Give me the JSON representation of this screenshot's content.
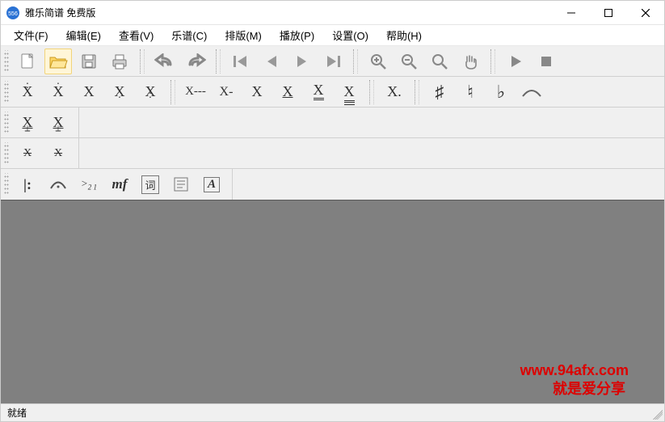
{
  "titlebar": {
    "title": "雅乐简谱 免费版"
  },
  "menu": {
    "file": "文件(F)",
    "edit": "编辑(E)",
    "view": "查看(V)",
    "score": "乐谱(C)",
    "layout": "排版(M)",
    "play": "播放(P)",
    "settings": "设置(O)",
    "help": "帮助(H)"
  },
  "toolbar1": {
    "new": "新建",
    "open": "打开",
    "save": "保存",
    "print": "打印",
    "undo": "撤销",
    "redo": "重做",
    "first": "首段",
    "prev": "上段",
    "next": "下段",
    "last": "末段",
    "zoomin": "放大",
    "zoomout": "缩小",
    "zoomfit": "缩放",
    "pan": "平移",
    "playbtn": "播放",
    "stop": "停止"
  },
  "row2": {
    "n1": "X",
    "n2": "X",
    "n3": "X",
    "n4": "X",
    "n5": "X",
    "d1": "X---",
    "d2": "X-",
    "d3": "X",
    "d4": "X",
    "d5": "X",
    "d6": "X",
    "dot": "X.",
    "sharp": "♯",
    "natural": "♮",
    "flat": "♭",
    "slur": "⌒"
  },
  "row3": {
    "t1": "X",
    "t2": "X",
    "t3": "X",
    "t4": "X"
  },
  "row4": {
    "repeat": "𝄇",
    "fermata": "⌒·",
    "tuplet": "21",
    "dyn": "mf",
    "lyrics": "词",
    "para": "≣",
    "font": "A"
  },
  "status": {
    "text": "就绪"
  },
  "watermark": {
    "url": "www.94afx.com",
    "tag": "就是爱分享"
  }
}
